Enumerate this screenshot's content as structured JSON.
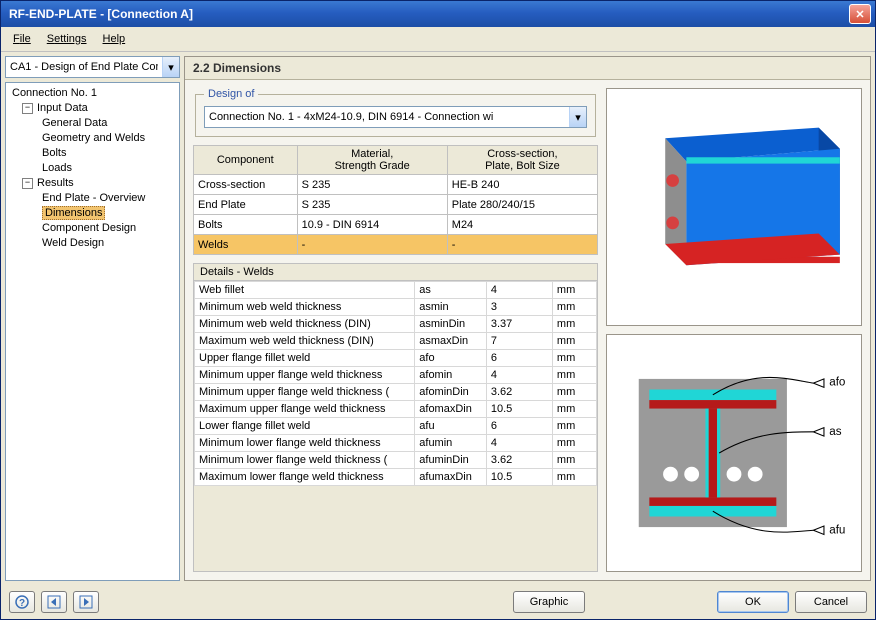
{
  "window": {
    "title": "RF-END-PLATE - [Connection A]"
  },
  "menu": {
    "file": "File",
    "settings": "Settings",
    "help": "Help"
  },
  "left_combo": {
    "value": "CA1 - Design of End Plate Conn"
  },
  "tree": {
    "root": "Connection No. 1",
    "input": "Input Data",
    "input_children": [
      "General Data",
      "Geometry and Welds",
      "Bolts",
      "Loads"
    ],
    "results": "Results",
    "results_children": [
      "End Plate - Overview",
      "Dimensions",
      "Component Design",
      "Weld Design"
    ],
    "selected": "Dimensions"
  },
  "panel": {
    "title": "2.2 Dimensions"
  },
  "design": {
    "legend": "Design of",
    "value": "Connection No. 1 - 4xM24-10.9, DIN 6914 - Connection wi"
  },
  "components_table": {
    "headers": {
      "component": "Component",
      "material": "Material,\nStrength Grade",
      "cross": "Cross-section,\nPlate, Bolt Size"
    },
    "rows": [
      {
        "component": "Cross-section",
        "material": "S 235",
        "cross": "HE-B 240"
      },
      {
        "component": "End Plate",
        "material": "S 235",
        "cross": "Plate 280/240/15"
      },
      {
        "component": "Bolts",
        "material": "10.9 - DIN 6914",
        "cross": "M24"
      },
      {
        "component": "Welds",
        "material": "-",
        "cross": "-",
        "selected": true
      }
    ]
  },
  "details": {
    "title": "Details - Welds",
    "rows": [
      {
        "param": "Web fillet",
        "sym": "as",
        "val": "4",
        "unit": "mm"
      },
      {
        "param": "Minimum web weld thickness",
        "sym": "asmin",
        "val": "3",
        "unit": "mm"
      },
      {
        "param": "Minimum web weld thickness (DIN)",
        "sym": "asminDin",
        "val": "3.37",
        "unit": "mm"
      },
      {
        "param": "Maximum web weld thickness (DIN)",
        "sym": "asmaxDin",
        "val": "7",
        "unit": "mm"
      },
      {
        "param": "Upper flange fillet weld",
        "sym": "afo",
        "val": "6",
        "unit": "mm"
      },
      {
        "param": "Minimum upper flange weld thickness",
        "sym": "afomin",
        "val": "4",
        "unit": "mm"
      },
      {
        "param": "Minimum upper flange weld thickness (",
        "sym": "afominDin",
        "val": "3.62",
        "unit": "mm"
      },
      {
        "param": "Maximum upper flange weld thickness",
        "sym": "afomaxDin",
        "val": "10.5",
        "unit": "mm"
      },
      {
        "param": "Lower flange fillet weld",
        "sym": "afu",
        "val": "6",
        "unit": "mm"
      },
      {
        "param": "Minimum lower flange weld thickness",
        "sym": "afumin",
        "val": "4",
        "unit": "mm"
      },
      {
        "param": "Minimum lower flange weld thickness (",
        "sym": "afuminDin",
        "val": "3.62",
        "unit": "mm"
      },
      {
        "param": "Maximum lower flange weld thickness",
        "sym": "afumaxDin",
        "val": "10.5",
        "unit": "mm"
      }
    ]
  },
  "diagram": {
    "afo": "afo",
    "as": "as",
    "afu": "afu"
  },
  "buttons": {
    "graphic": "Graphic",
    "ok": "OK",
    "cancel": "Cancel"
  }
}
